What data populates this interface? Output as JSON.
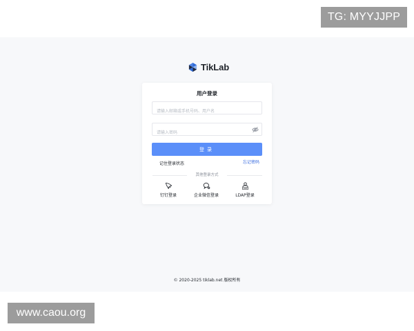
{
  "watermarks": {
    "top": "TG: MYYJJPP",
    "bottom": "www.caou.org"
  },
  "brand": {
    "name": "TikLab",
    "accent_color": "#5b8ff9"
  },
  "login_card": {
    "title": "用户登录",
    "username_placeholder": "请输入邮箱或手机号码、用户名",
    "password_placeholder": "请输入密码",
    "password_toggle_icon": "eye-off-icon",
    "submit_label": "登录",
    "remember_label": "记住登录状态",
    "forgot_label": "忘记密码",
    "other_methods_label": "其他登录方式",
    "other_methods": [
      {
        "label": "钉钉登录",
        "icon": "dingtalk-icon"
      },
      {
        "label": "企业微信登录",
        "icon": "wecom-icon"
      },
      {
        "label": "LDAP登录",
        "icon": "ldap-icon"
      }
    ]
  },
  "footer": {
    "copyright": "© 2020-2025 tiklab.net 版权所有"
  }
}
